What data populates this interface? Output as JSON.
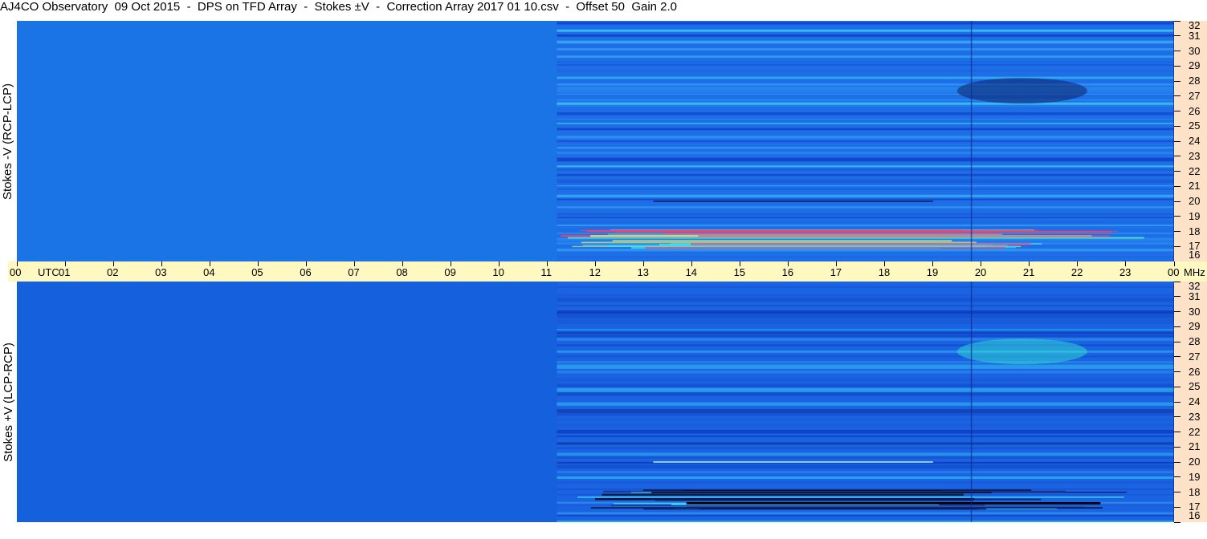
{
  "title": "AJ4CO Observatory  09 Oct 2015  -  DPS on TFD Array  -  Stokes ±V  -  Correction Array 2017 01 10.csv  -  Offset 50  Gain 2.0",
  "colors": {
    "background_blue": "#1a73e4",
    "timebar": "#fff8c0",
    "freqbar": "#fde2c8"
  },
  "chart_data": {
    "type": "heatmap",
    "title": "AJ4CO Observatory  09 Oct 2015  -  DPS on TFD Array  -  Stokes ±V  -  Correction Array 2017 01 10.csv  -  Offset 50  Gain 2.0",
    "x_axis": {
      "ticks": [
        "00",
        "01",
        "02",
        "03",
        "04",
        "05",
        "06",
        "07",
        "08",
        "09",
        "10",
        "11",
        "12",
        "13",
        "14",
        "15",
        "16",
        "17",
        "18",
        "19",
        "20",
        "21",
        "22",
        "23",
        "00"
      ],
      "unit_label": "UTC",
      "end_unit": "MHz",
      "range_hours": [
        0,
        24
      ]
    },
    "y_axis": {
      "ticks": [
        "16",
        "17",
        "18",
        "19",
        "20",
        "21",
        "22",
        "23",
        "24",
        "25",
        "26",
        "27",
        "28",
        "29",
        "30",
        "31",
        "32"
      ],
      "range_mhz": [
        16,
        32
      ]
    },
    "panels": [
      {
        "name": "Stokes -V (RCP-LCP)",
        "ylabel": "Stokes -V (RCP-LCP)",
        "base_color": "#1b74e5"
      },
      {
        "name": "Stokes +V (LCP-RCP)",
        "ylabel": "Stokes +V (LCP-RCP)",
        "base_color": "#1560dd"
      }
    ],
    "features": {
      "array_change_utc": 11.2,
      "rfi_band_mhz": [
        16.9,
        18.2
      ],
      "activity_region_utc": [
        19.5,
        22.2
      ],
      "activity_region_mhz": [
        26.5,
        28.2
      ],
      "vertical_lines_utc": [
        19.8,
        24.0
      ],
      "rfi_line_20mhz_utc": [
        13.2,
        19.0
      ]
    }
  }
}
